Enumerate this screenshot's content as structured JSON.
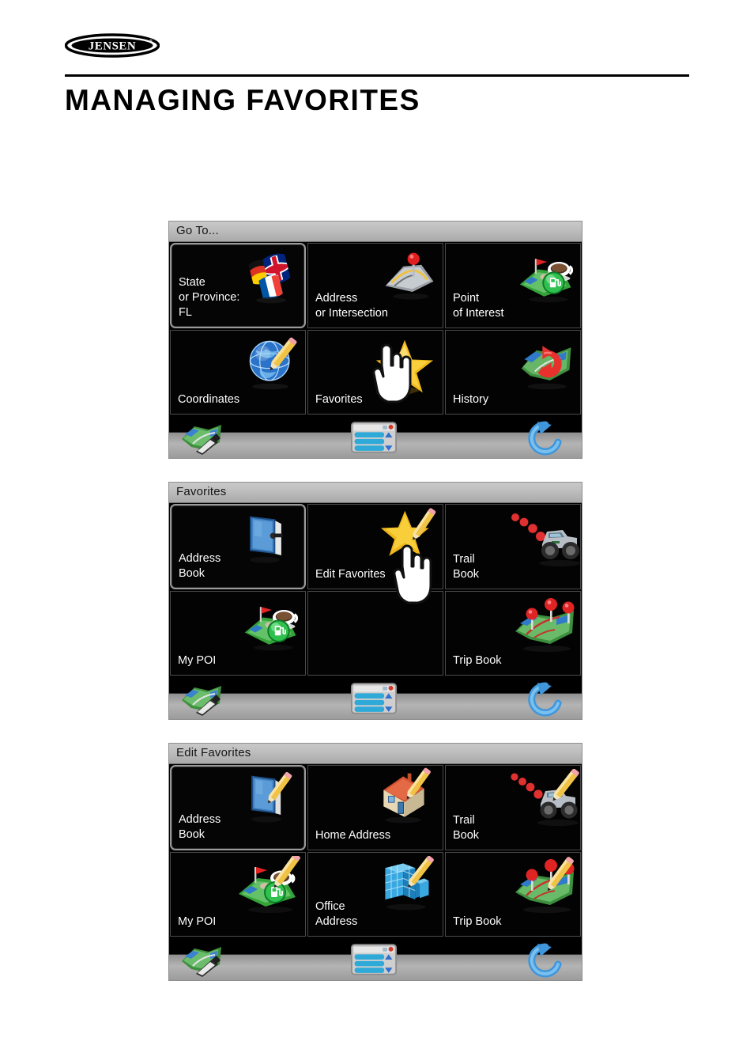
{
  "document": {
    "brand": "JENSEN",
    "title": "MANAGING FAVORITES"
  },
  "screens": [
    {
      "id": "go-to",
      "titlebar": "Go To...",
      "tiles": [
        {
          "label": "State\nor Province:\nFL",
          "icon": "flags-icon",
          "selected": true
        },
        {
          "label": "Address\nor Intersection",
          "icon": "road-pin-icon",
          "selected": false
        },
        {
          "label": "Point\nof Interest",
          "icon": "poi-icon",
          "selected": false
        },
        {
          "label": "Coordinates",
          "icon": "globe-pencil-icon",
          "selected": false
        },
        {
          "label": "Favorites",
          "icon": "star-icon",
          "selected": false
        },
        {
          "label": "History",
          "icon": "history-map-icon",
          "selected": false
        }
      ],
      "cursor_on_tile": 4,
      "toolbar": {
        "map_label": "map-icon",
        "menu_label": "menu-list-icon",
        "back_label": "back-arrow-icon"
      }
    },
    {
      "id": "favorites",
      "titlebar": "Favorites",
      "tiles": [
        {
          "label": "Address\nBook",
          "icon": "book-icon",
          "selected": true
        },
        {
          "label": "Edit Favorites",
          "icon": "star-pencil-icon",
          "selected": false
        },
        {
          "label": "Trail\nBook",
          "icon": "jeep-trail-icon",
          "selected": false
        },
        {
          "label": "My POI",
          "icon": "poi-icon",
          "selected": false
        },
        {
          "label": "",
          "icon": "",
          "selected": false
        },
        {
          "label": "Trip Book",
          "icon": "trip-map-pins-icon",
          "selected": false
        }
      ],
      "cursor_on_tile": 1,
      "toolbar": {
        "map_label": "map-icon",
        "menu_label": "menu-list-icon",
        "back_label": "back-arrow-icon"
      }
    },
    {
      "id": "edit-favorites",
      "titlebar": "Edit Favorites",
      "tiles": [
        {
          "label": "Address\nBook",
          "icon": "book-pencil-icon",
          "selected": true
        },
        {
          "label": "Home Address",
          "icon": "house-pencil-icon",
          "selected": false
        },
        {
          "label": "Trail\nBook",
          "icon": "jeep-pencil-icon",
          "selected": false
        },
        {
          "label": "My POI",
          "icon": "poi-pencil-icon",
          "selected": false
        },
        {
          "label": "Office\nAddress",
          "icon": "office-pencil-icon",
          "selected": false
        },
        {
          "label": "Trip Book",
          "icon": "trip-map-pencil-icon",
          "selected": false
        }
      ],
      "cursor_on_tile": -1,
      "toolbar": {
        "map_label": "map-icon",
        "menu_label": "menu-list-icon",
        "back_label": "back-arrow-icon"
      }
    }
  ],
  "colors": {
    "screen_bg": "#000000",
    "titlebar": "#bdbdbd",
    "tile_border": "#4a4a4a",
    "selected_border": "#9a9a9a",
    "label_text": "#ffffff",
    "star_yellow": "#f5c518",
    "pencil_yellow": "#f2c14a",
    "pin_red": "#e02020",
    "gas_green": "#22b24c",
    "back_blue": "#4a9fe0",
    "page_bg": "#ffffff"
  }
}
